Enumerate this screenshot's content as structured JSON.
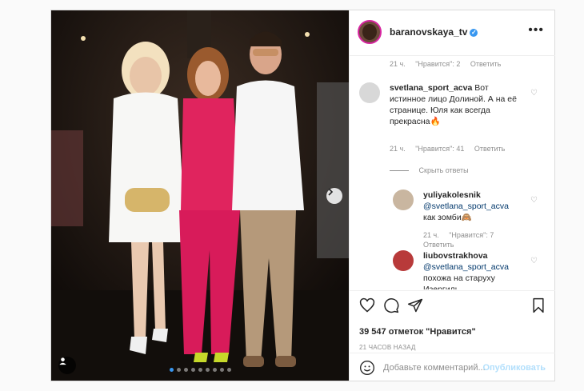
{
  "post": {
    "username": "baranovskaya_tv",
    "more_icon": "more-icon",
    "carousel": {
      "slides": 9,
      "active_index": 0
    }
  },
  "comments": [
    {
      "id": "prev",
      "meta": {
        "time": "21 ч.",
        "likes": "\"Нравится\": 2",
        "reply": "Ответить"
      }
    },
    {
      "id": "c1",
      "user": "svetlana_sport_acva",
      "text": "Вот истинное лицо Долиной. А на её странице. Юля как всегда прекрасна🔥",
      "meta": {
        "time": "21 ч.",
        "likes": "\"Нравится\": 41",
        "reply": "Ответить"
      },
      "hide_replies": "Скрыть ответы"
    },
    {
      "id": "r1",
      "user": "yuliyakolesnik",
      "mention": "@svetlana_sport_acva",
      "text": "как зомби🙈",
      "meta": {
        "time": "21 ч.",
        "likes": "\"Нравится\": 7",
        "reply": "Ответить"
      }
    },
    {
      "id": "r2",
      "user": "liubovstrakhova",
      "mention": "@svetlana_sport_acva",
      "text": "похожа на старуху Изергиль"
    }
  ],
  "actions": {
    "likes": "39 547 отметок \"Нравится\"",
    "time": "21 ЧАСОВ НАЗАД"
  },
  "add_comment": {
    "placeholder": "Добавьте комментарий...",
    "publish": "Опубликовать"
  },
  "colors": {
    "accent": "#3897f0",
    "muted": "#8e8e8e",
    "publish_disabled": "#b2dffc"
  }
}
